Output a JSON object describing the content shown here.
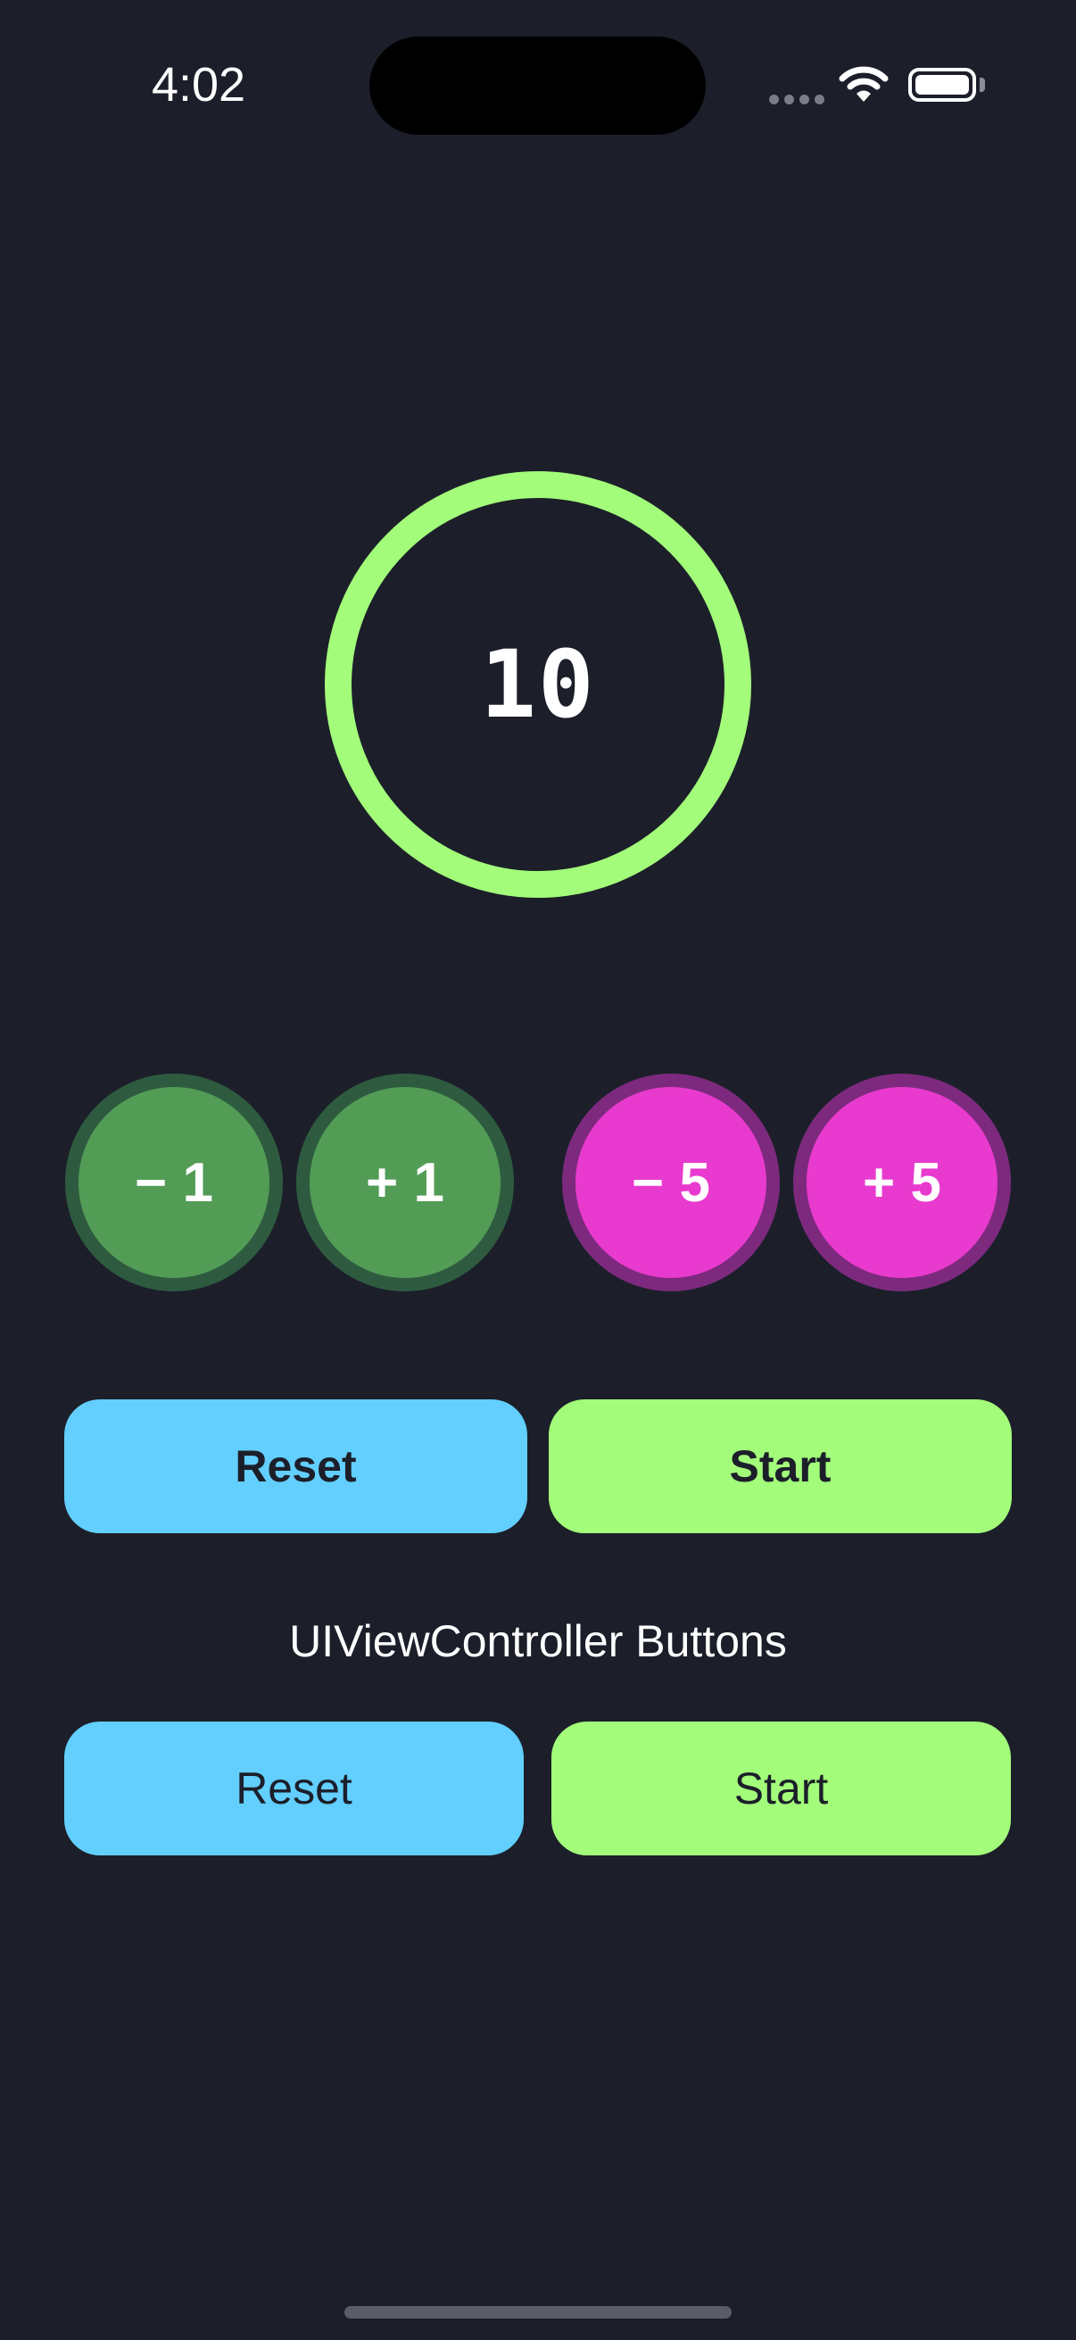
{
  "status_bar": {
    "time": "4:02",
    "icons": [
      "cellular-signal-icon",
      "wifi-icon",
      "battery-icon"
    ]
  },
  "counter": {
    "value": "10",
    "ring_color": "#a3fd7a"
  },
  "step_buttons": [
    {
      "label": "− 1",
      "color": "#529c56"
    },
    {
      "label": "+ 1",
      "color": "#529c56"
    },
    {
      "label": "− 5",
      "color": "#e83ace"
    },
    {
      "label": "+ 5",
      "color": "#e83ace"
    }
  ],
  "primary_buttons": {
    "reset_label": "Reset",
    "start_label": "Start",
    "reset_color": "#62cffe",
    "start_color": "#a3fd7a"
  },
  "uiviewcontroller_section": {
    "heading": "UIViewController Buttons",
    "reset_label": "Reset",
    "start_label": "Start"
  },
  "colors": {
    "background": "#1c1f2a"
  }
}
